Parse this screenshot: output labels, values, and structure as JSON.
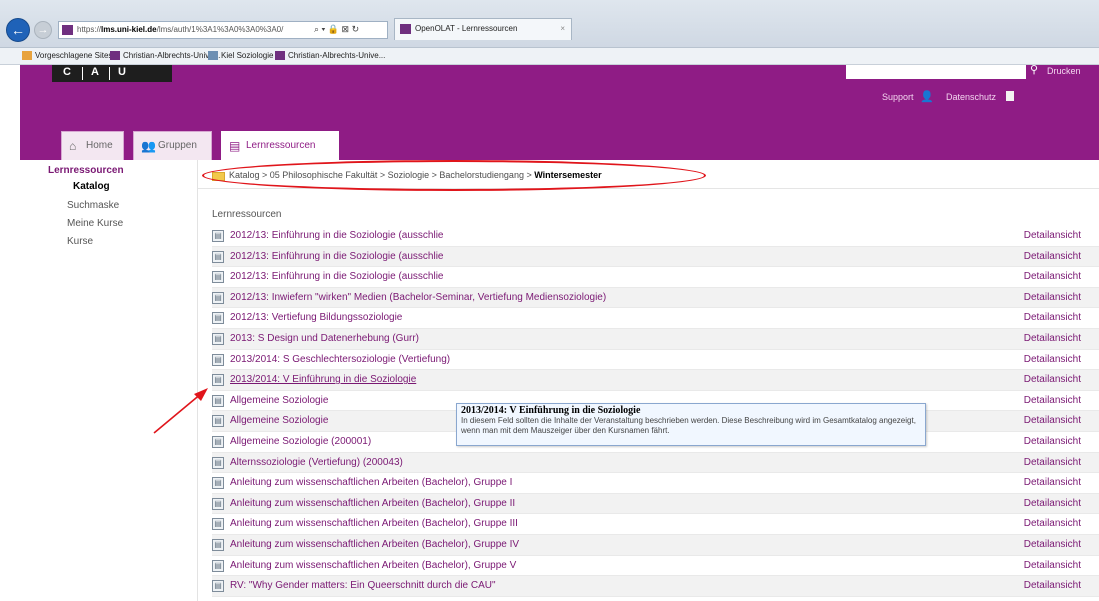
{
  "browser": {
    "url_prefix": "https://",
    "url_domain": "lms.uni-kiel.de",
    "url_rest": "/lms/auth/1%3A1%3A0%3A0%3A0/",
    "address_controls": "⌕ ▾ 🔒 ⊠ ↻",
    "tab_title": "OpenOLAT - Lernressourcen",
    "tab_close": "×"
  },
  "bookmarks": [
    {
      "label": "Vorgeschlagene Sites ▾",
      "color": "#e8a33d"
    },
    {
      "label": "Christian-Albrechts-Unive...",
      "color": "#6f2f7f"
    },
    {
      "label": "Kiel Soziologie",
      "color": "#6d8fb3"
    },
    {
      "label": "Christian-Albrechts-Unive...",
      "color": "#6f2f7f"
    }
  ],
  "header": {
    "logo": [
      "C",
      "A",
      "U"
    ],
    "print_label": "Drucken",
    "support_label": "Support",
    "privacy_label": "Datenschutz",
    "tabs": [
      {
        "label": "Home",
        "icon": "⌂"
      },
      {
        "label": "Gruppen",
        "icon": "👥"
      },
      {
        "label": "Lernressourcen",
        "icon": "▤"
      }
    ]
  },
  "nav": {
    "title": "Lernressourcen",
    "items": [
      "Katalog",
      "Suchmaske",
      "Meine Kurse",
      "Kurse"
    ]
  },
  "breadcrumb": {
    "path": "Katalog > 05 Philosophische Fakultät > Soziologie > Bachelorstudiengang > ",
    "current": "Wintersemester"
  },
  "list": {
    "heading": "Lernressourcen",
    "detail_label": "Detailansicht",
    "rows": [
      "2012/13: Einführung in die Soziologie (ausschlie",
      "2012/13: Einführung in die Soziologie (ausschlie",
      "2012/13: Einführung in die Soziologie (ausschlie",
      "2012/13: Inwiefern \"wirken\" Medien (Bachelor-Seminar, Vertiefung Mediensoziologie)",
      "2012/13: Vertiefung Bildungssoziologie",
      "2013: S Design und Datenerhebung (Gurr)",
      "2013/2014: S Geschlechtersoziologie (Vertiefung)",
      "2013/2014: V Einführung in die Soziologie",
      "Allgemeine Soziologie",
      "Allgemeine Soziologie",
      "Allgemeine Soziologie (200001)",
      "Alternssoziologie (Vertiefung) (200043)",
      "Anleitung zum wissenschaftlichen Arbeiten (Bachelor), Gruppe I",
      "Anleitung zum wissenschaftlichen Arbeiten (Bachelor), Gruppe II",
      "Anleitung zum wissenschaftlichen Arbeiten (Bachelor), Gruppe III",
      "Anleitung zum wissenschaftlichen Arbeiten (Bachelor), Gruppe IV",
      "Anleitung zum wissenschaftlichen Arbeiten (Bachelor), Gruppe V",
      "RV: \"Why Gender matters: Ein Queerschnitt durch die CAU\""
    ],
    "hovered_index": 7
  },
  "tooltip": {
    "title": "2013/2014: V Einführung in die Soziologie",
    "text": "In diesem Feld sollten die Inhalte der Veranstaltung beschrieben werden. Diese Beschreibung wird im Gesamtkatalog angezeigt, wenn man mit dem Mauszeiger über den Kursnamen fährt."
  },
  "colors": {
    "brand": "#8f1c85",
    "link": "#7a1873",
    "annotation": "#e0151b"
  }
}
